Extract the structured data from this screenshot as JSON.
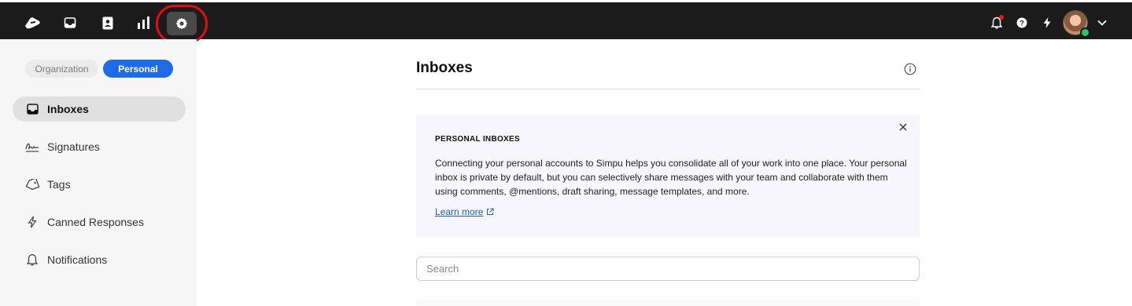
{
  "topbar": {
    "left_icons": [
      "logo-icon",
      "inbox-icon",
      "contacts-icon",
      "analytics-icon",
      "settings-icon"
    ],
    "right_icons": [
      "bell-icon",
      "help-icon",
      "bolt-icon",
      "avatar",
      "chevron-down-icon"
    ],
    "highlight_color": "#e10d0d",
    "background": "#1b1b1b"
  },
  "sidebar": {
    "toggle": {
      "organization": "Organization",
      "personal": "Personal",
      "selected": "Personal"
    },
    "items": [
      {
        "label": "Inboxes",
        "icon": "inbox-icon",
        "active": true
      },
      {
        "label": "Signatures",
        "icon": "signature-icon",
        "active": false
      },
      {
        "label": "Tags",
        "icon": "tag-icon",
        "active": false
      },
      {
        "label": "Canned Responses",
        "icon": "bolt-icon",
        "active": false
      },
      {
        "label": "Notifications",
        "icon": "bell-icon",
        "active": false
      }
    ]
  },
  "main": {
    "title": "Inboxes",
    "banner": {
      "title": "PERSONAL INBOXES",
      "text": "Connecting your personal accounts to Simpu helps you consolidate all of your work into one place. Your personal inbox is private by default, but you can selectively share messages with your team and collaborate with them using comments, @mentions, draft sharing, message templates, and more.",
      "link": "Learn more"
    },
    "search": {
      "placeholder": "Search",
      "value": ""
    }
  },
  "colors": {
    "accent": "#1f6ae6",
    "status_online": "#2ec36b",
    "notification": "#e21c1c"
  }
}
